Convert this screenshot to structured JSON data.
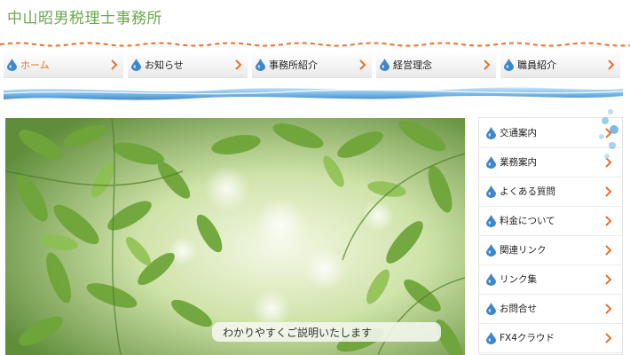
{
  "site": {
    "title": "中山昭男税理士事務所"
  },
  "nav": {
    "items": [
      {
        "label": "ホーム",
        "active": true
      },
      {
        "label": "お知らせ",
        "active": false
      },
      {
        "label": "事務所紹介",
        "active": false
      },
      {
        "label": "経営理念",
        "active": false
      },
      {
        "label": "職員紹介",
        "active": false
      }
    ]
  },
  "hero": {
    "caption": "わかりやすくご説明いたします"
  },
  "sidebar": {
    "items": [
      {
        "label": "交通案内"
      },
      {
        "label": "業務案内"
      },
      {
        "label": "よくある質問"
      },
      {
        "label": "料金について"
      },
      {
        "label": "関連リンク"
      },
      {
        "label": "リンク集"
      },
      {
        "label": "お問合せ"
      },
      {
        "label": "FX4クラウド"
      }
    ]
  },
  "colors": {
    "title_green": "#6aa84f",
    "accent_orange": "#e8702a",
    "drop_blue": "#3f87c8",
    "wave_blue": "#6fb3e6"
  },
  "icons": {
    "nav_item": "water-drop-icon",
    "nav_arrow": "chevron-right-icon",
    "side_item": "water-drop-icon",
    "side_arrow": "chevron-right-icon"
  }
}
